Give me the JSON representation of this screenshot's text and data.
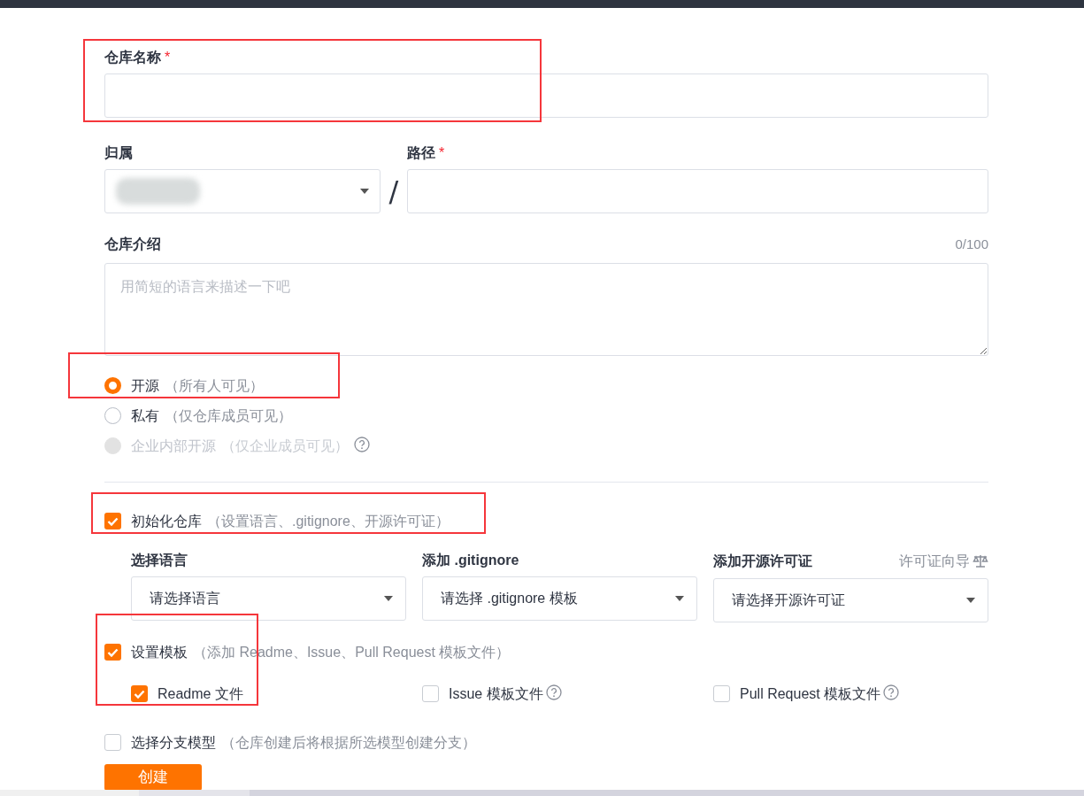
{
  "repo_name": {
    "label": "仓库名称",
    "required_mark": "*",
    "highlighted": true
  },
  "owner": {
    "label": "归属"
  },
  "path_separator": "/",
  "path": {
    "label": "路径",
    "required_mark": "*"
  },
  "description": {
    "label": "仓库介绍",
    "counter": "0/100",
    "placeholder": "用简短的语言来描述一下吧"
  },
  "visibility": [
    {
      "label": "开源",
      "note": "（所有人可见）",
      "selected": true,
      "disabled": false,
      "help": false,
      "highlighted": true
    },
    {
      "label": "私有",
      "note": "（仅仓库成员可见）",
      "selected": false,
      "disabled": false,
      "help": false,
      "highlighted": false
    },
    {
      "label": "企业内部开源",
      "note": "（仅企业成员可见）",
      "selected": false,
      "disabled": true,
      "help": true,
      "highlighted": false
    }
  ],
  "init_repo": {
    "label": "初始化仓库",
    "note": "（设置语言、.gitignore、开源许可证）",
    "checked": true,
    "highlighted": true
  },
  "init_selects": [
    {
      "label": "选择语言",
      "value": "请选择语言"
    },
    {
      "label": "添加 .gitignore",
      "value": "请选择 .gitignore 模板"
    },
    {
      "label": "添加开源许可证",
      "value": "请选择开源许可证",
      "link": "许可证向导"
    }
  ],
  "template": {
    "label": "设置模板",
    "note": "（添加 Readme、Issue、Pull Request 模板文件）",
    "checked": true,
    "highlighted": true
  },
  "template_files": [
    {
      "label": "Readme 文件",
      "checked": true,
      "help": false
    },
    {
      "label": "Issue 模板文件",
      "checked": false,
      "help": true
    },
    {
      "label": "Pull Request 模板文件",
      "checked": false,
      "help": true
    }
  ],
  "branch_model": {
    "label": "选择分支模型",
    "note": "（仓库创建后将根据所选模型创建分支）",
    "checked": false
  },
  "submit_button": "创建"
}
